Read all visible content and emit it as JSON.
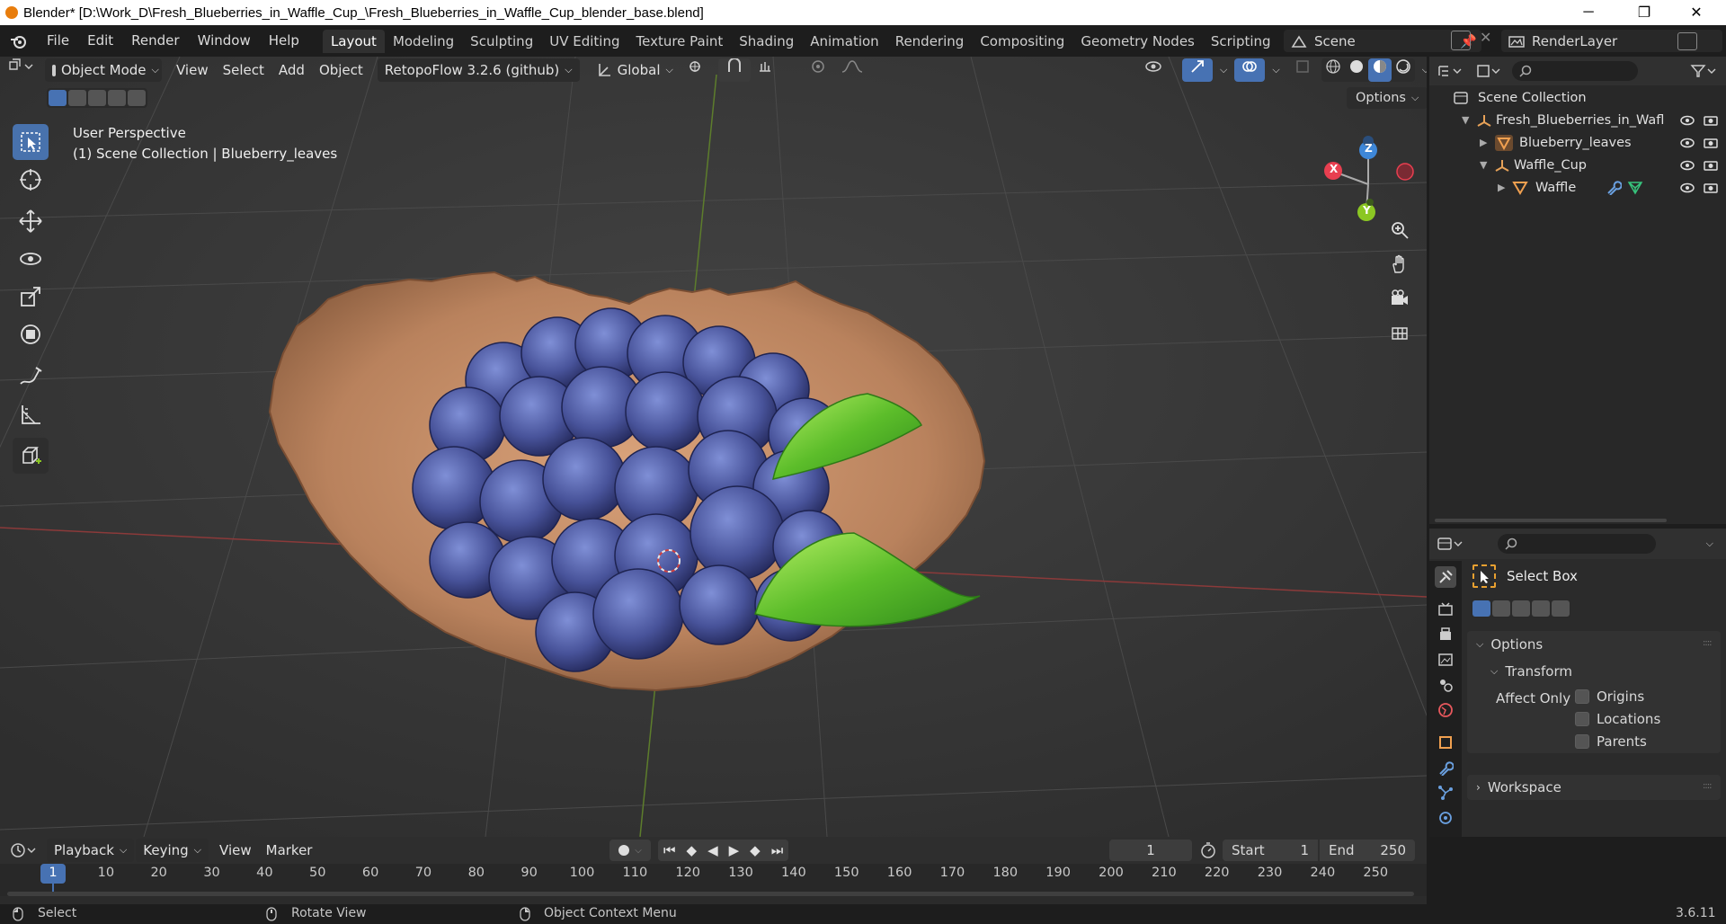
{
  "window": {
    "title": "Blender* [D:\\Work_D\\Fresh_Blueberries_in_Waffle_Cup_\\Fresh_Blueberries_in_Waffle_Cup_blender_base.blend]",
    "controls": [
      "─",
      "❐",
      "✕"
    ]
  },
  "menu": [
    "File",
    "Edit",
    "Render",
    "Window",
    "Help"
  ],
  "workspaces": {
    "tabs": [
      "Layout",
      "Modeling",
      "Sculpting",
      "UV Editing",
      "Texture Paint",
      "Shading",
      "Animation",
      "Rendering",
      "Compositing",
      "Geometry Nodes",
      "Scripting"
    ],
    "active": "Layout",
    "add_symbol": "+"
  },
  "scene": {
    "name": "Scene",
    "view_layer": "RenderLayer"
  },
  "viewport_header": {
    "mode": "Object Mode",
    "menus": [
      "View",
      "Select",
      "Add",
      "Object"
    ],
    "addon": "RetopoFlow 3.2.6 (github)",
    "orientation": "Global",
    "options_label": "Options"
  },
  "viewport": {
    "perspective": "User Perspective",
    "collection_info": "(1) Scene Collection | Blueberry_leaves",
    "gizmo": {
      "x": "X",
      "y": "Y",
      "z": "Z"
    }
  },
  "outliner": {
    "root": "Scene Collection",
    "items": [
      {
        "name": "Fresh_Blueberries_in_Wafl",
        "type": "empty"
      },
      {
        "name": "Blueberry_leaves",
        "type": "mesh"
      },
      {
        "name": "Waffle_Cup",
        "type": "empty"
      },
      {
        "name": "Waffle",
        "type": "mesh"
      }
    ]
  },
  "properties": {
    "tool_name": "Select Box",
    "options_label": "Options",
    "transform_label": "Transform",
    "affect_only_label": "Affect Only",
    "affect_options": [
      {
        "label": "Origins",
        "checked": false
      },
      {
        "label": "Locations",
        "checked": false
      },
      {
        "label": "Parents",
        "checked": false
      }
    ],
    "workspace_label": "Workspace"
  },
  "timeline": {
    "menus": [
      "Playback",
      "Keying",
      "View",
      "Marker"
    ],
    "current_frame": "1",
    "start_label": "Start",
    "start": "1",
    "end_label": "End",
    "end": "250",
    "ticks": [
      "1",
      "10",
      "20",
      "30",
      "40",
      "50",
      "60",
      "70",
      "80",
      "90",
      "100",
      "110",
      "120",
      "130",
      "140",
      "150",
      "160",
      "170",
      "180",
      "190",
      "200",
      "210",
      "220",
      "230",
      "240",
      "250"
    ]
  },
  "status": {
    "select": "Select",
    "rotate": "Rotate View",
    "context": "Object Context Menu",
    "version": "3.6.11"
  },
  "colors": {
    "accent": "#4772b3",
    "x_axis": "#e83f50",
    "y_axis": "#8bc723",
    "z_axis": "#3e87d8",
    "panel": "#2b2b2b",
    "viewport": "#393939"
  }
}
